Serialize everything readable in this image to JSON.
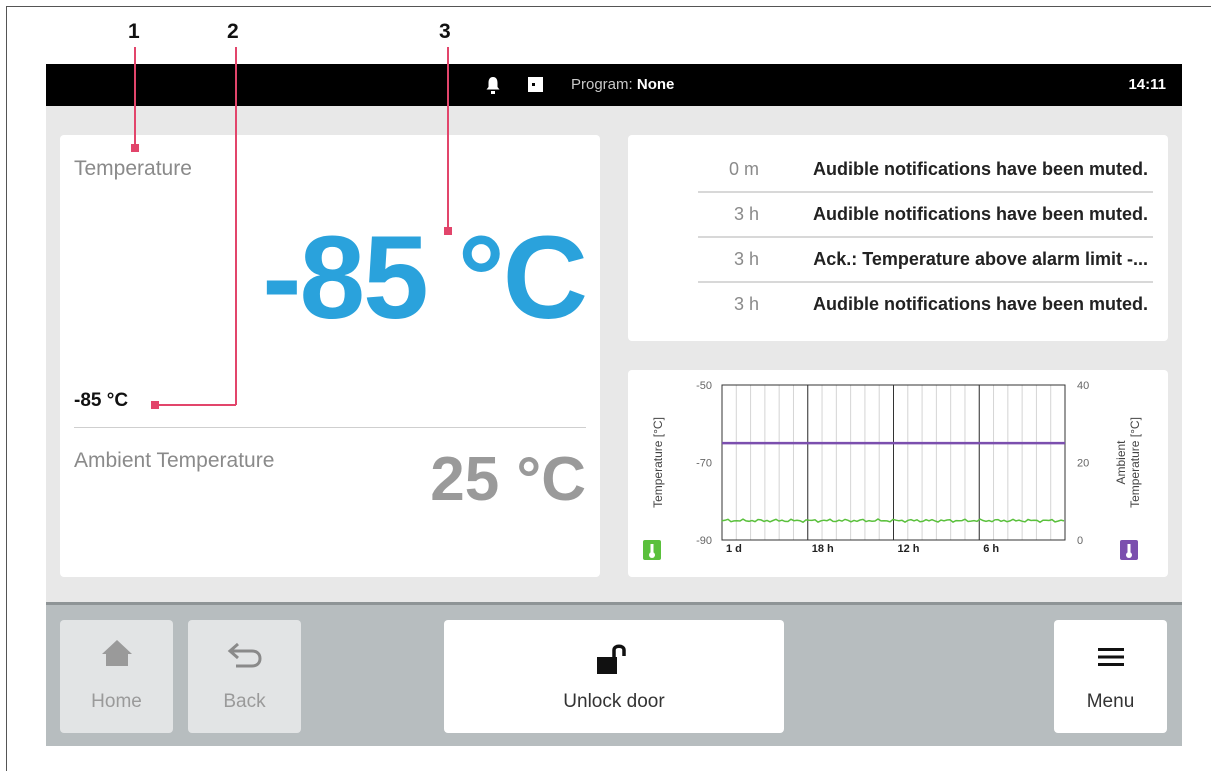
{
  "callouts": [
    "1",
    "2",
    "3"
  ],
  "statusbar": {
    "program_label": "Program:",
    "program_value": "None",
    "clock": "14:11"
  },
  "temperature": {
    "title": "Temperature",
    "value": "-85 °C",
    "setpoint": "-85 °C",
    "ambient_title": "Ambient Temperature",
    "ambient_value": "25 °C"
  },
  "notifications": [
    {
      "time": "0 m",
      "text": "Audible notifications have been muted."
    },
    {
      "time": "3 h",
      "text": "Audible notifications have been muted."
    },
    {
      "time": "3 h",
      "text": "Ack.: Temperature above alarm limit -..."
    },
    {
      "time": "3 h",
      "text": "Audible notifications have been muted."
    }
  ],
  "chart_data": {
    "type": "line",
    "x_categories": [
      "1 d",
      "18 h",
      "12 h",
      "6 h"
    ],
    "ylabel_left": "Temperature [°C]",
    "ylabel_right": "Ambient Temperature [°C]",
    "ylim_left": [
      -90,
      -50
    ],
    "ylim_right": [
      0,
      40
    ],
    "yticks_left": [
      -50,
      -70,
      -90
    ],
    "yticks_right": [
      40,
      20,
      0
    ],
    "series": [
      {
        "axis": "right",
        "color": "#7b4fae",
        "values": [
          25,
          25,
          25,
          25,
          25
        ]
      },
      {
        "axis": "left",
        "color": "#5ac03c",
        "values": [
          -85,
          -85,
          -85,
          -85,
          -85
        ]
      }
    ],
    "grid": true
  },
  "bottom": {
    "home_label": "Home",
    "back_label": "Back",
    "unlock_label": "Unlock door",
    "menu_label": "Menu"
  },
  "colors": {
    "accent_temp": "#2aa2dc",
    "chart_temp": "#5ac03c",
    "chart_ambient": "#7b4fae",
    "callout_line": "#e2456b"
  },
  "icons": [
    "bell-icon",
    "door-icon",
    "home-icon",
    "back-icon",
    "unlock-icon",
    "menu-icon",
    "thermometer-icon"
  ]
}
